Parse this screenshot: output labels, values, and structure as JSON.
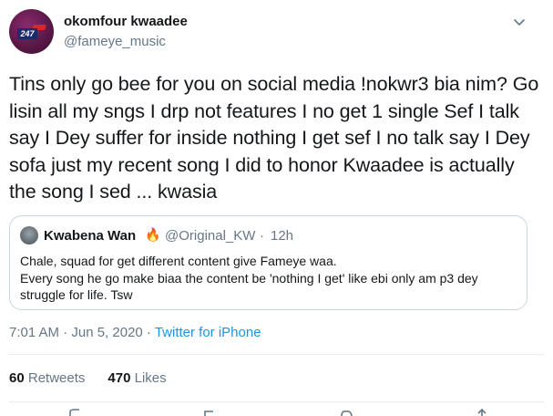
{
  "author": {
    "name": "okomfour kwaadee",
    "handle": "@fameye_music",
    "avatar_badge": "247"
  },
  "tweet": {
    "text": "Tins only go bee for you on social media !nokwr3 bia nim? Go lisin all my sngs I drp not features I no get 1 single Sef I talk say I Dey suffer for inside nothing I get sef I no talk say I Dey sofa just my recent song I did to honor  Kwaadee is actually the song I sed ... kwasia"
  },
  "quoted_tweet": {
    "name": "Kwabena Wan",
    "name_emoji": "🔥",
    "handle": "@Original_KW",
    "separator": "·",
    "time": "12h",
    "line1": "Chale, squad for get different content give Fameye waa.",
    "line2": "Every song he go make biaa the content be 'nothing I get' like ebi only am p3 dey struggle for life. Tsw"
  },
  "meta": {
    "timestamp": "7:01 AM · Jun 5, 2020 · ",
    "source": "Twitter for iPhone"
  },
  "stats": {
    "retweets_count": "60",
    "retweets_label": "Retweets",
    "likes_count": "470",
    "likes_label": "Likes"
  },
  "icons": [
    "chevron-down-icon",
    "reply-icon",
    "retweet-icon",
    "like-icon",
    "share-icon"
  ],
  "colors": {
    "text": "#14171a",
    "secondary": "#657786",
    "link": "#1b95e0",
    "border": "#ccd6dd"
  }
}
